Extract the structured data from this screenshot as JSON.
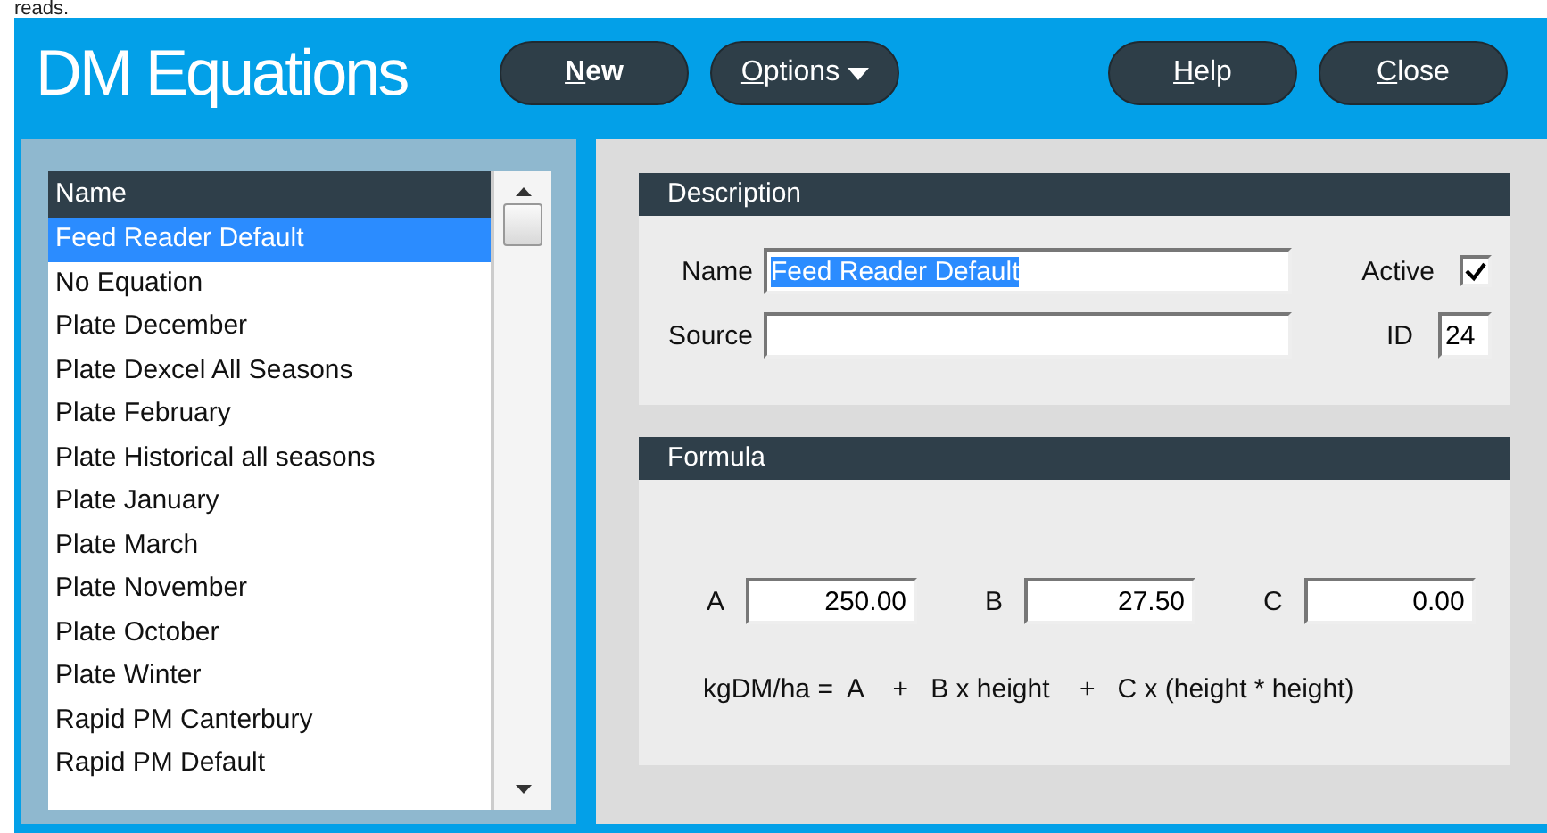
{
  "caption": "reads.",
  "window": {
    "title": "DM Equations"
  },
  "toolbar": {
    "left": [
      {
        "label": "New",
        "bold": true,
        "dropdown": false
      },
      {
        "label": "Options",
        "bold": false,
        "dropdown": true
      }
    ],
    "right": [
      {
        "label": "Help",
        "bold": false,
        "dropdown": false
      },
      {
        "label": "Close",
        "bold": false,
        "dropdown": false
      }
    ]
  },
  "list": {
    "column": "Name",
    "items": [
      {
        "label": "Feed Reader Default",
        "selected": true
      },
      {
        "label": "No Equation",
        "selected": false
      },
      {
        "label": "Plate December",
        "selected": false
      },
      {
        "label": "Plate Dexcel All Seasons",
        "selected": false
      },
      {
        "label": "Plate February",
        "selected": false
      },
      {
        "label": "Plate Historical all seasons",
        "selected": false
      },
      {
        "label": "Plate January",
        "selected": false
      },
      {
        "label": "Plate March",
        "selected": false
      },
      {
        "label": "Plate November",
        "selected": false
      },
      {
        "label": "Plate October",
        "selected": false
      },
      {
        "label": "Plate Winter",
        "selected": false
      },
      {
        "label": "Rapid PM Canterbury",
        "selected": false
      },
      {
        "label": "Rapid PM Default",
        "selected": false
      }
    ]
  },
  "description": {
    "title": "Description",
    "name_label": "Name",
    "name_value": "Feed Reader Default",
    "name_value_selected": true,
    "source_label": "Source",
    "active_label": "Active",
    "active": true,
    "id_label": "ID",
    "id_value": "24"
  },
  "formula": {
    "title": "Formula",
    "coefficients": [
      {
        "label": "A",
        "value": "250.00"
      },
      {
        "label": "B",
        "value": "27.50"
      },
      {
        "label": "C",
        "value": "0.00"
      }
    ],
    "equation": "kgDM/ha =  A    +   B x height    +   C x (height * height)"
  }
}
